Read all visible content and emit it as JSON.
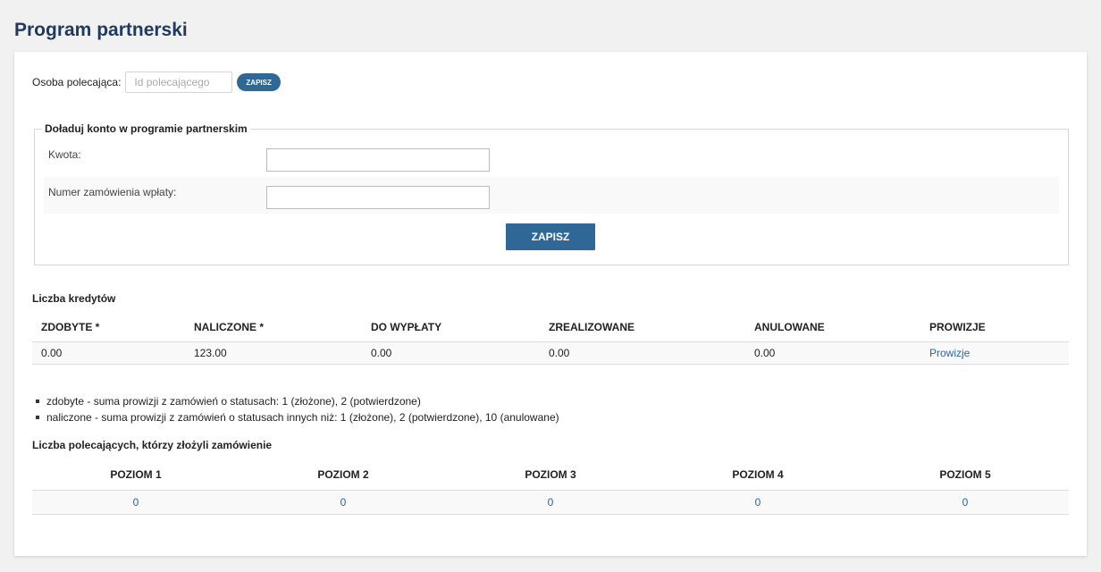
{
  "page": {
    "title": "Program partnerski"
  },
  "referrer": {
    "label": "Osoba polecająca:",
    "placeholder": "Id polecającego",
    "save_label": "ZAPISZ"
  },
  "topup": {
    "legend": "Doładuj konto w programie partnerskim",
    "amount_label": "Kwota:",
    "amount_value": "",
    "order_label": "Numer zamówienia wpłaty:",
    "order_value": "",
    "save_label": "ZAPISZ"
  },
  "credits": {
    "title": "Liczba kredytów",
    "headers": [
      "ZDOBYTE *",
      "NALICZONE *",
      "DO WYPŁATY",
      "ZREALIZOWANE",
      "ANULOWANE",
      "PROWIZJE"
    ],
    "row": [
      "0.00",
      "123.00",
      "0.00",
      "0.00",
      "0.00",
      "Prowizje"
    ]
  },
  "notes": [
    "zdobyte - suma prowizji z zamówień o statusach: 1 (złożone), 2 (potwierdzone)",
    "naliczone - suma prowizji z zamówień o statusach innych niż: 1 (złożone), 2 (potwierdzone), 10 (anulowane)"
  ],
  "referrals": {
    "title": "Liczba polecających, którzy złożyli zamówienie",
    "headers": [
      "POZIOM 1",
      "POZIOM 2",
      "POZIOM 3",
      "POZIOM 4",
      "POZIOM 5"
    ],
    "values": [
      "0",
      "0",
      "0",
      "0",
      "0"
    ]
  },
  "colors": {
    "accent": "#2f6896",
    "title": "#1e3a5f",
    "link": "#2a66a6",
    "background": "#f1f1f1"
  }
}
